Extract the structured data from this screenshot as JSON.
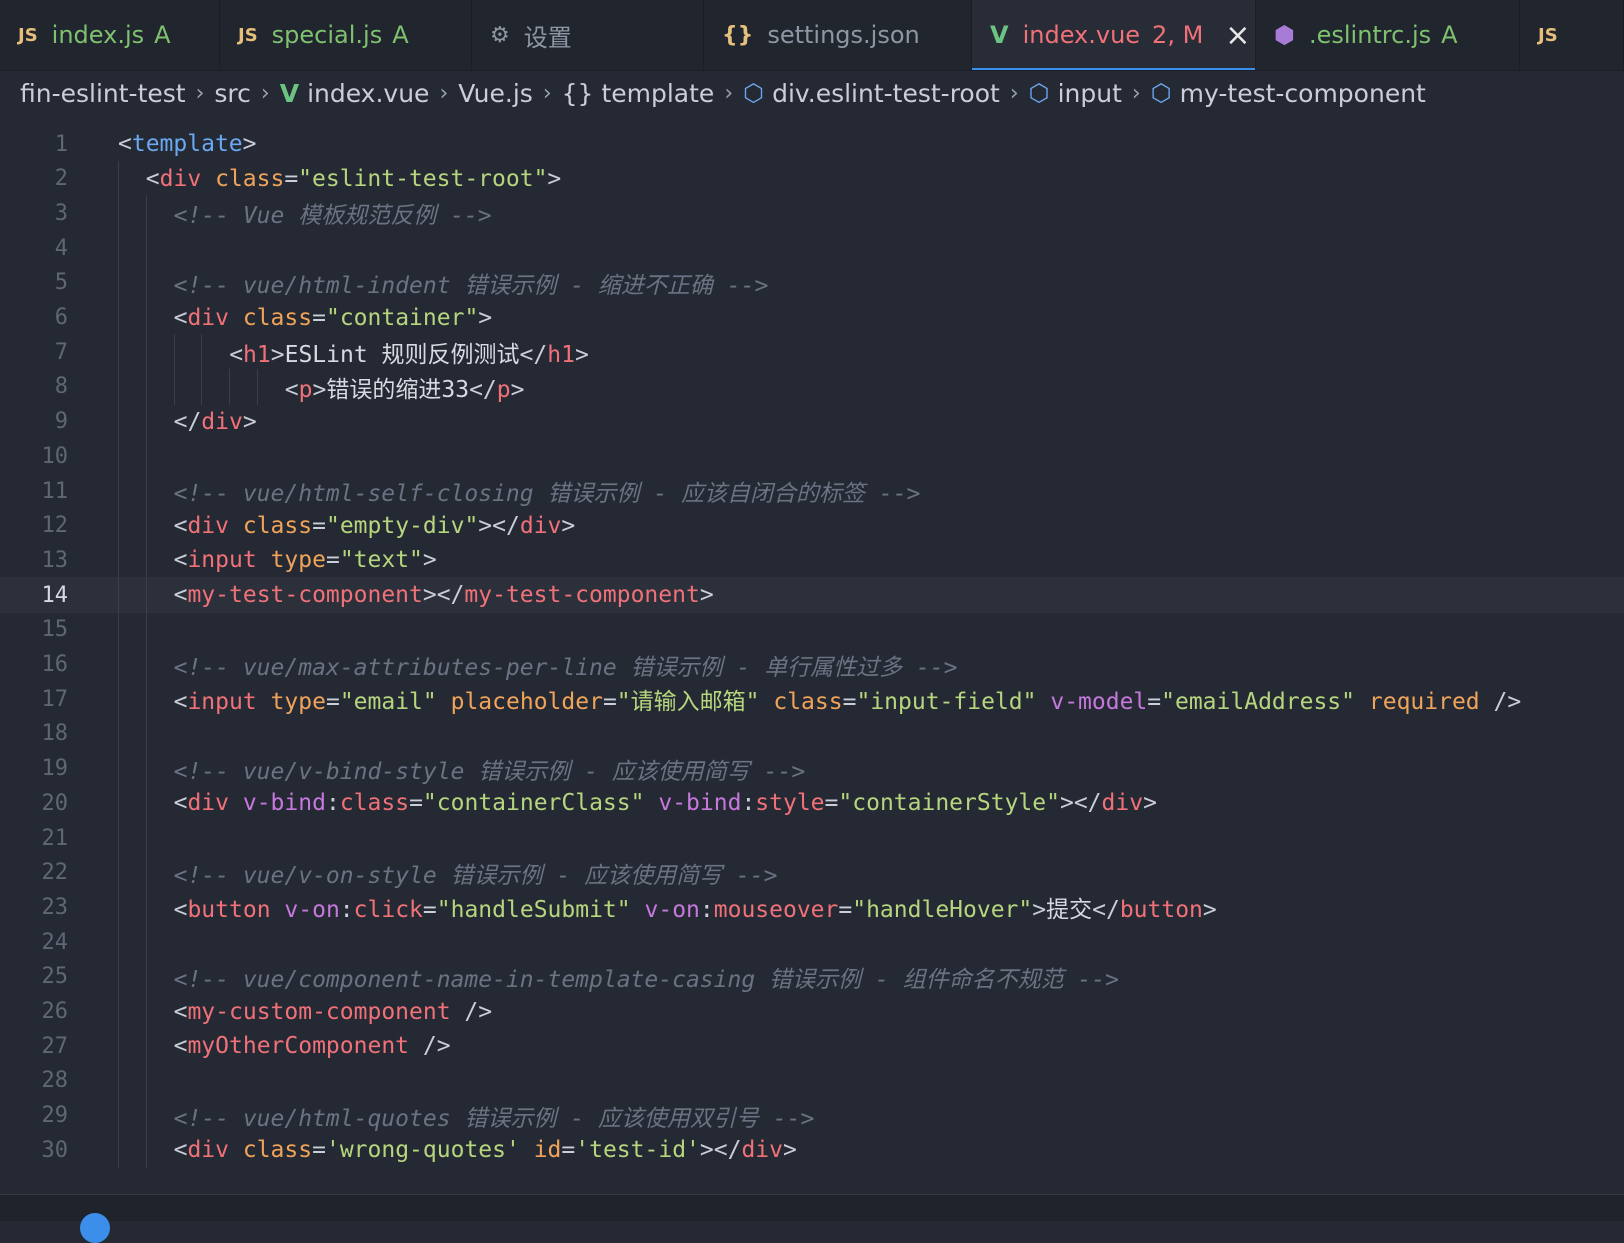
{
  "tabs": [
    {
      "icon": "JS",
      "name": "index.js",
      "badge": "A",
      "type": "js"
    },
    {
      "icon": "JS",
      "name": "special.js",
      "badge": "A",
      "type": "js"
    },
    {
      "icon": "⚙",
      "name": "设置",
      "badge": "",
      "type": "settings"
    },
    {
      "icon": "{}",
      "name": "settings.json",
      "badge": "",
      "type": "json"
    },
    {
      "icon": "V",
      "name": "index.vue",
      "badge": "2, M",
      "type": "vue",
      "active": true
    },
    {
      "icon": "⬢",
      "name": ".eslintrc.js",
      "badge": "A",
      "type": "eslint"
    },
    {
      "icon": "JS",
      "name": "",
      "badge": "",
      "type": "js-partial"
    }
  ],
  "breadcrumb": {
    "items": [
      {
        "label": "fin-eslint-test",
        "icon": ""
      },
      {
        "label": "src",
        "icon": ""
      },
      {
        "label": "index.vue",
        "icon": "vue-icon"
      },
      {
        "label": "Vue.js",
        "icon": ""
      },
      {
        "label": "template",
        "icon": "braces-icon"
      },
      {
        "label": "div.eslint-test-root",
        "icon": "cube-icon"
      },
      {
        "label": "input",
        "icon": "cube-icon"
      },
      {
        "label": "my-test-component",
        "icon": "cube-icon"
      }
    ]
  },
  "editor": {
    "current_line": 14,
    "lines": [
      {
        "n": "1",
        "indent": 0,
        "tokens": [
          [
            "punc",
            "<"
          ],
          [
            "tpl",
            "template"
          ],
          [
            "punc",
            ">"
          ]
        ]
      },
      {
        "n": "2",
        "indent": 1,
        "tokens": [
          [
            "punc",
            "<"
          ],
          [
            "tag",
            "div"
          ],
          [
            "punc",
            " "
          ],
          [
            "attr",
            "class"
          ],
          [
            "punc",
            "="
          ],
          [
            "str",
            "\"eslint-test-root\""
          ],
          [
            "punc",
            ">"
          ]
        ]
      },
      {
        "n": "3",
        "indent": 2,
        "tokens": [
          [
            "com",
            "<!-- Vue 模板规范反例 -->"
          ]
        ]
      },
      {
        "n": "4",
        "indent": 2,
        "tokens": []
      },
      {
        "n": "5",
        "indent": 2,
        "tokens": [
          [
            "com",
            "<!-- vue/html-indent 错误示例 - 缩进不正确 -->"
          ]
        ]
      },
      {
        "n": "6",
        "indent": 2,
        "tokens": [
          [
            "punc",
            "<"
          ],
          [
            "tag",
            "div"
          ],
          [
            "punc",
            " "
          ],
          [
            "attr",
            "class"
          ],
          [
            "punc",
            "="
          ],
          [
            "str",
            "\"container\""
          ],
          [
            "punc",
            ">"
          ]
        ]
      },
      {
        "n": "7",
        "indent": 4,
        "tokens": [
          [
            "punc",
            "<"
          ],
          [
            "tag",
            "h1"
          ],
          [
            "punc",
            ">"
          ],
          [
            "text",
            "ESLint 规则反例测试"
          ],
          [
            "punc",
            "</"
          ],
          [
            "tag",
            "h1"
          ],
          [
            "punc",
            ">"
          ]
        ]
      },
      {
        "n": "8",
        "indent": 6,
        "tokens": [
          [
            "punc",
            "<"
          ],
          [
            "tag",
            "p"
          ],
          [
            "punc",
            ">"
          ],
          [
            "text",
            "错误的缩进33"
          ],
          [
            "punc",
            "</"
          ],
          [
            "tag",
            "p"
          ],
          [
            "punc",
            ">"
          ]
        ]
      },
      {
        "n": "9",
        "indent": 2,
        "tokens": [
          [
            "punc",
            "</"
          ],
          [
            "tag",
            "div"
          ],
          [
            "punc",
            ">"
          ]
        ]
      },
      {
        "n": "10",
        "indent": 2,
        "tokens": []
      },
      {
        "n": "11",
        "indent": 2,
        "tokens": [
          [
            "com",
            "<!-- vue/html-self-closing 错误示例 - 应该自闭合的标签 -->"
          ]
        ]
      },
      {
        "n": "12",
        "indent": 2,
        "tokens": [
          [
            "punc",
            "<"
          ],
          [
            "tag",
            "div"
          ],
          [
            "punc",
            " "
          ],
          [
            "attr",
            "class"
          ],
          [
            "punc",
            "="
          ],
          [
            "str",
            "\"empty-div\""
          ],
          [
            "punc",
            "></"
          ],
          [
            "tag",
            "div"
          ],
          [
            "punc",
            ">"
          ]
        ]
      },
      {
        "n": "13",
        "indent": 2,
        "tokens": [
          [
            "punc",
            "<"
          ],
          [
            "tag",
            "input"
          ],
          [
            "punc",
            " "
          ],
          [
            "attr",
            "type"
          ],
          [
            "punc",
            "="
          ],
          [
            "str",
            "\"text\""
          ],
          [
            "punc",
            ">"
          ]
        ]
      },
      {
        "n": "14",
        "indent": 2,
        "tokens": [
          [
            "punc",
            "<"
          ],
          [
            "tag",
            "my-test-component"
          ],
          [
            "punc",
            "></"
          ],
          [
            "tag",
            "my-test-component"
          ],
          [
            "punc",
            ">"
          ]
        ]
      },
      {
        "n": "15",
        "indent": 2,
        "tokens": []
      },
      {
        "n": "16",
        "indent": 2,
        "tokens": [
          [
            "com",
            "<!-- vue/max-attributes-per-line 错误示例 - 单行属性过多 -->"
          ]
        ]
      },
      {
        "n": "17",
        "indent": 2,
        "tokens": [
          [
            "punc",
            "<"
          ],
          [
            "tag",
            "input"
          ],
          [
            "punc",
            " "
          ],
          [
            "attr",
            "type"
          ],
          [
            "punc",
            "="
          ],
          [
            "str",
            "\"email\""
          ],
          [
            "punc",
            " "
          ],
          [
            "attr",
            "placeholder"
          ],
          [
            "punc",
            "="
          ],
          [
            "str",
            "\"请输入邮箱\""
          ],
          [
            "punc",
            " "
          ],
          [
            "attr",
            "class"
          ],
          [
            "punc",
            "="
          ],
          [
            "str",
            "\"input-field\""
          ],
          [
            "punc",
            " "
          ],
          [
            "dir",
            "v-model"
          ],
          [
            "punc",
            "="
          ],
          [
            "str",
            "\"emailAddress\""
          ],
          [
            "punc",
            " "
          ],
          [
            "attr",
            "required"
          ],
          [
            "punc",
            " />"
          ]
        ]
      },
      {
        "n": "18",
        "indent": 2,
        "tokens": []
      },
      {
        "n": "19",
        "indent": 2,
        "tokens": [
          [
            "com",
            "<!-- vue/v-bind-style 错误示例 - 应该使用简写 -->"
          ]
        ]
      },
      {
        "n": "20",
        "indent": 2,
        "tokens": [
          [
            "punc",
            "<"
          ],
          [
            "tag",
            "div"
          ],
          [
            "punc",
            " "
          ],
          [
            "dir",
            "v-bind"
          ],
          [
            "punc",
            ":"
          ],
          [
            "tag",
            "class"
          ],
          [
            "punc",
            "="
          ],
          [
            "str",
            "\"containerClass\""
          ],
          [
            "punc",
            " "
          ],
          [
            "dir",
            "v-bind"
          ],
          [
            "punc",
            ":"
          ],
          [
            "tag",
            "style"
          ],
          [
            "punc",
            "="
          ],
          [
            "str",
            "\"containerStyle\""
          ],
          [
            "punc",
            "></"
          ],
          [
            "tag",
            "div"
          ],
          [
            "punc",
            ">"
          ]
        ]
      },
      {
        "n": "21",
        "indent": 2,
        "tokens": []
      },
      {
        "n": "22",
        "indent": 2,
        "tokens": [
          [
            "com",
            "<!-- vue/v-on-style 错误示例 - 应该使用简写 -->"
          ]
        ]
      },
      {
        "n": "23",
        "indent": 2,
        "tokens": [
          [
            "punc",
            "<"
          ],
          [
            "tag",
            "button"
          ],
          [
            "punc",
            " "
          ],
          [
            "dir",
            "v-on"
          ],
          [
            "punc",
            ":"
          ],
          [
            "tag",
            "click"
          ],
          [
            "punc",
            "="
          ],
          [
            "str",
            "\"handleSubmit\""
          ],
          [
            "punc",
            " "
          ],
          [
            "dir",
            "v-on"
          ],
          [
            "punc",
            ":"
          ],
          [
            "tag",
            "mouseover"
          ],
          [
            "punc",
            "="
          ],
          [
            "str",
            "\"handleHover\""
          ],
          [
            "punc",
            ">"
          ],
          [
            "text",
            "提交"
          ],
          [
            "punc",
            "</"
          ],
          [
            "tag",
            "button"
          ],
          [
            "punc",
            ">"
          ]
        ]
      },
      {
        "n": "24",
        "indent": 2,
        "tokens": []
      },
      {
        "n": "25",
        "indent": 2,
        "tokens": [
          [
            "com",
            "<!-- vue/component-name-in-template-casing 错误示例 - 组件命名不规范 -->"
          ]
        ]
      },
      {
        "n": "26",
        "indent": 2,
        "tokens": [
          [
            "punc",
            "<"
          ],
          [
            "tag",
            "my-custom-component"
          ],
          [
            "punc",
            " />"
          ]
        ]
      },
      {
        "n": "27",
        "indent": 2,
        "tokens": [
          [
            "punc",
            "<"
          ],
          [
            "tag",
            "myOtherComponent"
          ],
          [
            "punc",
            " />"
          ]
        ]
      },
      {
        "n": "28",
        "indent": 2,
        "tokens": []
      },
      {
        "n": "29",
        "indent": 2,
        "tokens": [
          [
            "com",
            "<!-- vue/html-quotes 错误示例 - 应该使用双引号 -->"
          ]
        ]
      },
      {
        "n": "30",
        "indent": 2,
        "tokens": [
          [
            "punc",
            "<"
          ],
          [
            "tag",
            "div"
          ],
          [
            "punc",
            " "
          ],
          [
            "attr",
            "class"
          ],
          [
            "punc",
            "="
          ],
          [
            "str",
            "'wrong-quotes'"
          ],
          [
            "punc",
            " "
          ],
          [
            "attr",
            "id"
          ],
          [
            "punc",
            "="
          ],
          [
            "str",
            "'test-id'"
          ],
          [
            "punc",
            "></"
          ],
          [
            "tag",
            "div"
          ],
          [
            "punc",
            ">"
          ]
        ]
      }
    ]
  },
  "colors": {
    "background": "#252934",
    "tag": "#f07178",
    "attribute": "#f0a45a",
    "directive": "#c678dd",
    "string": "#b6d67e",
    "comment": "#6b7282",
    "accent": "#3b8eea"
  }
}
